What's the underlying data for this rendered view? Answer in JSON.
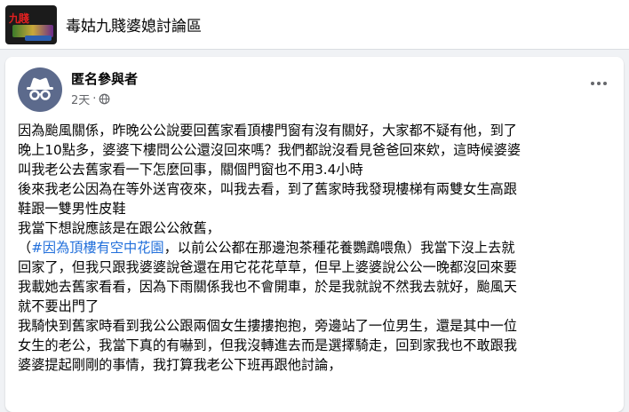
{
  "group": {
    "title": "毒姑九賤婆媳討論區",
    "thumb_text": "九賤"
  },
  "post": {
    "author": "匿名參與者",
    "time": "2天",
    "separator": "·",
    "privacy_icon": "globe-icon",
    "more_icon": "more-options-icon",
    "lines": [
      "因為颱風關係，昨晚公公說要回舊家看頂樓門窗有沒有關好，大家都不疑有他，到了",
      "晚上10點多，婆婆下樓問公公還沒回來嗎？我們都說沒看見爸爸回來欸，這時候婆婆",
      "叫我老公去舊家看一下怎麼回事，關個門窗也不用3.4小時",
      "後來我老公因為在等外送宵夜來，叫我去看，到了舊家時我發現樓梯有兩雙女生高跟",
      "鞋跟一雙男性皮鞋",
      "我當下想說應該是在跟公公敘舊，"
    ],
    "hashtag_line": {
      "prefix": "（",
      "hashtag": "#因為頂樓有空中花園",
      "suffix": "，以前公公都在那邊泡茶種花養鸚鵡喂魚）我當下沒上去就"
    },
    "lines_after": [
      "回家了，但我只跟我婆婆說爸還在用它花花草草，但早上婆婆說公公一晚都沒回來要",
      "我載她去舊家看看，因為下雨關係我也不會開車，於是我就說不然我去就好，颱風天",
      "就不要出門了",
      "我騎快到舊家時看到我公公跟兩個女生摟摟抱抱，旁邊站了一位男生，還是其中一位",
      "女生的老公，我當下真的有嚇到，但我沒轉進去而是選擇騎走，回到家我也不敢跟我",
      "婆婆提起剛剛的事情，我打算我老公下班再跟他討論，"
    ]
  },
  "colors": {
    "link": "#216fdb",
    "secondary_text": "#65676b",
    "avatar_bg": "#5c6a8c"
  }
}
